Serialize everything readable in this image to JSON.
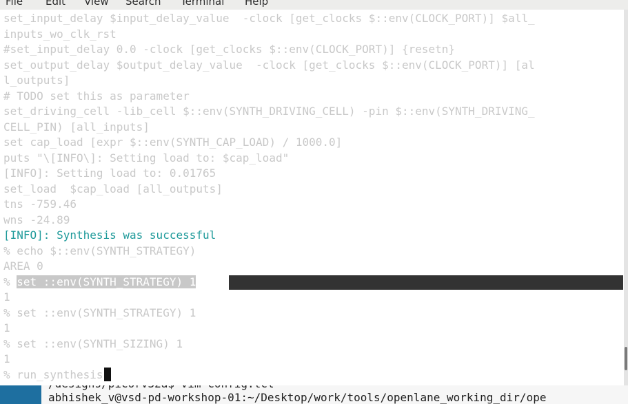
{
  "menu": {
    "items": [
      "File",
      "Edit",
      "View",
      "Search",
      "Terminal",
      "Help"
    ]
  },
  "terminal": {
    "lines": [
      "set_input_delay $input_delay_value  -clock [get_clocks $::env(CLOCK_PORT)] $all_",
      "inputs_wo_clk_rst",
      "#set_input_delay 0.0 -clock [get_clocks $::env(CLOCK_PORT)] {resetn}",
      "set_output_delay $output_delay_value  -clock [get_clocks $::env(CLOCK_PORT)] [al",
      "l_outputs]",
      "# TODO set this as parameter",
      "set_driving_cell -lib_cell $::env(SYNTH_DRIVING_CELL) -pin $::env(SYNTH_DRIVING_",
      "CELL_PIN) [all_inputs]",
      "set cap_load [expr $::env(SYNTH_CAP_LOAD) / 1000.0]",
      "puts \"\\[INFO\\]: Setting load to: $cap_load\"",
      "[INFO]: Setting load to: 0.01765",
      "set_load  $cap_load [all_outputs]",
      "tns -759.46",
      "wns -24.89",
      "[INFO]: Synthesis was successful",
      "% echo $::env(SYNTH_STRATEGY)",
      "AREA 0"
    ],
    "highlight_prompt": "% ",
    "highlight_command": "set ::env(SYNTH_STRATEGY) 1",
    "result_1": "1",
    "blank": "",
    "cmd2": "% set ::env(SYNTH_STRATEGY) 1",
    "result_2": "1",
    "cmd3": "% set ::env(SYNTH_SIZING) 1",
    "result_3": "1",
    "cmd4": "% run_synthesis"
  },
  "background_terminal": {
    "line1": "/designs/picorv32a$ vim config.tcl",
    "line2": "abhishek_v@vsd-pd-workshop-01:~/Desktop/work/tools/openlane_working_dir/ope"
  },
  "colors": {
    "text": "#c9c9c9",
    "info": "#1e9a9a",
    "cursorline": "#333333",
    "highlight_bg": "#c8c8c8"
  }
}
